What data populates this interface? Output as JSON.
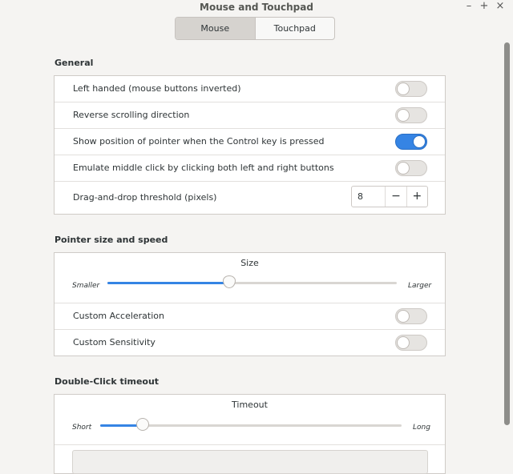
{
  "window": {
    "title": "Mouse and Touchpad",
    "buttons": {
      "minimize": "–",
      "maximize": "+",
      "close": "×"
    }
  },
  "tabs": [
    {
      "label": "Mouse",
      "active": true
    },
    {
      "label": "Touchpad",
      "active": false
    }
  ],
  "general": {
    "title": "General",
    "left_handed": {
      "label": "Left handed (mouse buttons inverted)",
      "on": false
    },
    "reverse_scroll": {
      "label": "Reverse scrolling direction",
      "on": false
    },
    "show_pointer": {
      "label": "Show position of pointer when the Control key is pressed",
      "on": true
    },
    "emulate_middle": {
      "label": "Emulate middle click by clicking both left and right buttons",
      "on": false
    },
    "drag_threshold": {
      "label": "Drag-and-drop threshold (pixels)",
      "value": "8",
      "minus": "−",
      "plus": "+"
    }
  },
  "pointer": {
    "title": "Pointer size and speed",
    "size": {
      "label": "Size",
      "min_label": "Smaller",
      "max_label": "Larger",
      "level": 0.42
    },
    "custom_accel": {
      "label": "Custom Acceleration",
      "on": false
    },
    "custom_sens": {
      "label": "Custom Sensitivity",
      "on": false
    }
  },
  "double_click": {
    "title": "Double-Click timeout",
    "timeout": {
      "label": "Timeout",
      "min_label": "Short",
      "max_label": "Long",
      "level": 0.14
    }
  },
  "colors": {
    "accent": "#3584e4",
    "background": "#f5f4f2"
  }
}
